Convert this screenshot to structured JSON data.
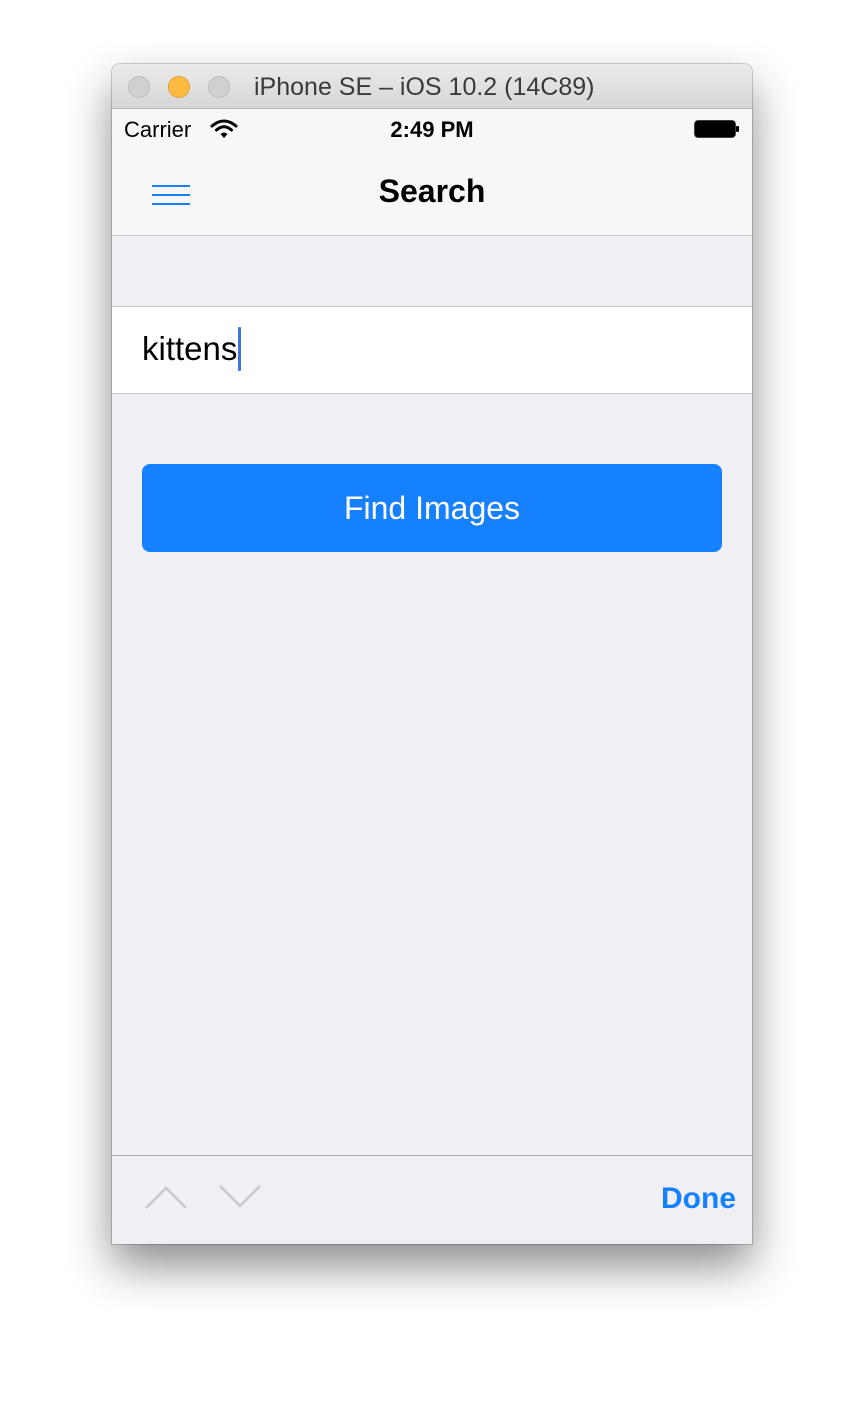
{
  "window": {
    "title": "iPhone SE – iOS 10.2 (14C89)"
  },
  "status_bar": {
    "carrier": "Carrier",
    "time": "2:49 PM"
  },
  "nav_bar": {
    "title": "Search",
    "menu_icon": "hamburger-menu-icon"
  },
  "search": {
    "value": "kittens"
  },
  "find_button": {
    "label": "Find Images"
  },
  "keyboard_toolbar": {
    "previous_icon": "chevron-up-icon",
    "next_icon": "chevron-down-icon",
    "done_label": "Done"
  },
  "colors": {
    "accent": "#1681ff",
    "caret": "#3f73e6",
    "background": "#efeff4"
  }
}
